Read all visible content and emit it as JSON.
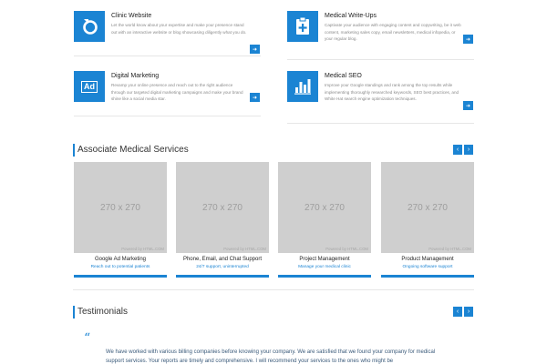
{
  "services": [
    {
      "id": "clinic-website",
      "title": "Clinic Website",
      "icon": "pointer-refresh-icon",
      "desc": "Let the world know about your expertise and make your presence stand out with an interactive website or blog showcasing diligently what you do.",
      "go_icon": "arrow-right-icon"
    },
    {
      "id": "medical-write-ups",
      "title": "Medical Write-Ups",
      "icon": "clipboard-plus-icon",
      "desc": "Captivate your audience with engaging content and copywriting, be it web content, marketing sales copy, email newsletters, medical infopedia, or your regular blog.",
      "go_icon": "arrow-right-icon"
    },
    {
      "id": "digital-marketing",
      "title": "Digital Marketing",
      "icon": "ad-icon",
      "icon_text": "Ad",
      "desc": "Revamp your online presence and reach out to the right audience through our targeted digital marketing campaigns and make your brand shine like a social media star.",
      "go_icon": "arrow-right-icon"
    },
    {
      "id": "medical-seo",
      "title": "Medical SEO",
      "icon": "bar-chart-icon",
      "desc": "Improve your Google standings and rank among the top results while implementing thoroughly researched keywords, SEO best practices, and White Hat search engine optimization techniques.",
      "go_icon": "arrow-right-icon"
    }
  ],
  "associate": {
    "title": "Associate Medical Services",
    "prev": "‹",
    "next": "›",
    "cards": [
      {
        "img_text": "270 x 270",
        "powered": "Powered by HTML.COM",
        "name": "Google Ad Marketing",
        "sub": "Reach out to potential patients"
      },
      {
        "img_text": "270 x 270",
        "powered": "Powered by HTML.COM",
        "name": "Phone, Email, and Chat Support",
        "sub": "24/7 support, uninterrupted"
      },
      {
        "img_text": "270 x 270",
        "powered": "Powered by HTML.COM",
        "name": "Project Management",
        "sub": "Manage your medical clinic"
      },
      {
        "img_text": "270 x 270",
        "powered": "Powered by HTML.COM",
        "name": "Product Management",
        "sub": "Ongoing software support"
      }
    ]
  },
  "testimonials": {
    "title": "Testimonials",
    "prev": "‹",
    "next": "›",
    "quote_mark": "“",
    "text": "We have worked with various billing companies before knowing your company. We are satisfied that we found your company for medical support services. Your reports are timely and comprehensive. I will recommend your services to the ones who might be"
  },
  "colors": {
    "accent": "#1b84d3",
    "placeholder": "#cfcfcf"
  }
}
